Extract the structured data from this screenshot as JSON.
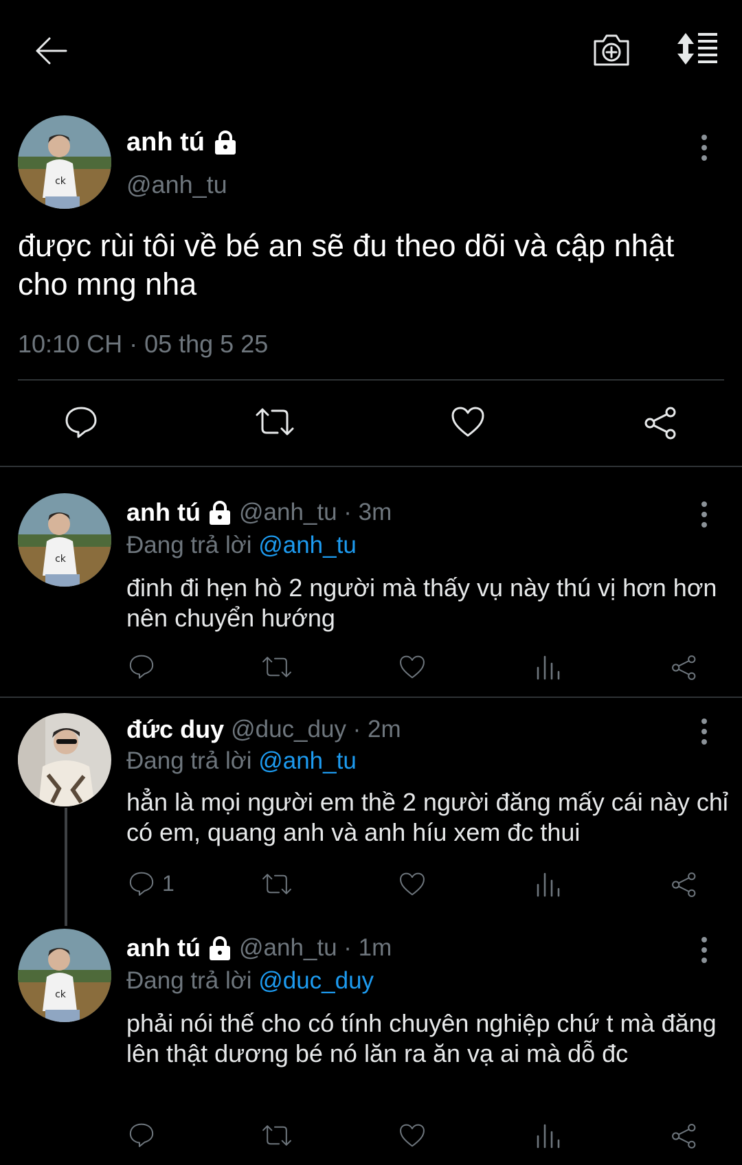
{
  "main_tweet": {
    "name": "anh tú",
    "handle": "@anh_tu",
    "text": "được rùi tôi về bé an sẽ đu theo dõi và cập nhật cho mng nha",
    "timestamp": "10:10 CH · 05 thg 5 25"
  },
  "replies": [
    {
      "name": "anh tú",
      "handle_time": "@anh_tu · 3m",
      "replying_prefix": "Đang trả lời",
      "replying_to": "@anh_tu",
      "text": "đinh đi hẹn hò 2 người mà thấy vụ này thú vị hơn hơn nên chuyển hướng",
      "reply_count": ""
    },
    {
      "name": "đức duy",
      "handle_time": "@duc_duy · 2m",
      "replying_prefix": "Đang trả lời",
      "replying_to": "@anh_tu",
      "text": "hẳn là mọi người em thề 2 người đăng mấy cái này chỉ có em, quang anh và anh híu xem đc thui",
      "reply_count": "1"
    },
    {
      "name": "anh tú",
      "handle_time": "@anh_tu · 1m",
      "replying_prefix": "Đang trả lời",
      "replying_to": "@duc_duy",
      "text": "phải nói thế cho có tính chuyên nghiệp chứ t mà đăng lên thật dương bé nó lăn ra ăn vạ ai mà dỗ đc",
      "reply_count": ""
    }
  ],
  "icons": [
    "back-arrow-icon",
    "camera-plus-icon",
    "sort-icon",
    "lock-icon",
    "more-icon",
    "reply-icon",
    "retweet-icon",
    "like-icon",
    "views-icon",
    "share-icon"
  ],
  "colors": {
    "background": "#000000",
    "link": "#1d9bf0",
    "muted": "#6e767d",
    "text": "#e7e9ea"
  }
}
